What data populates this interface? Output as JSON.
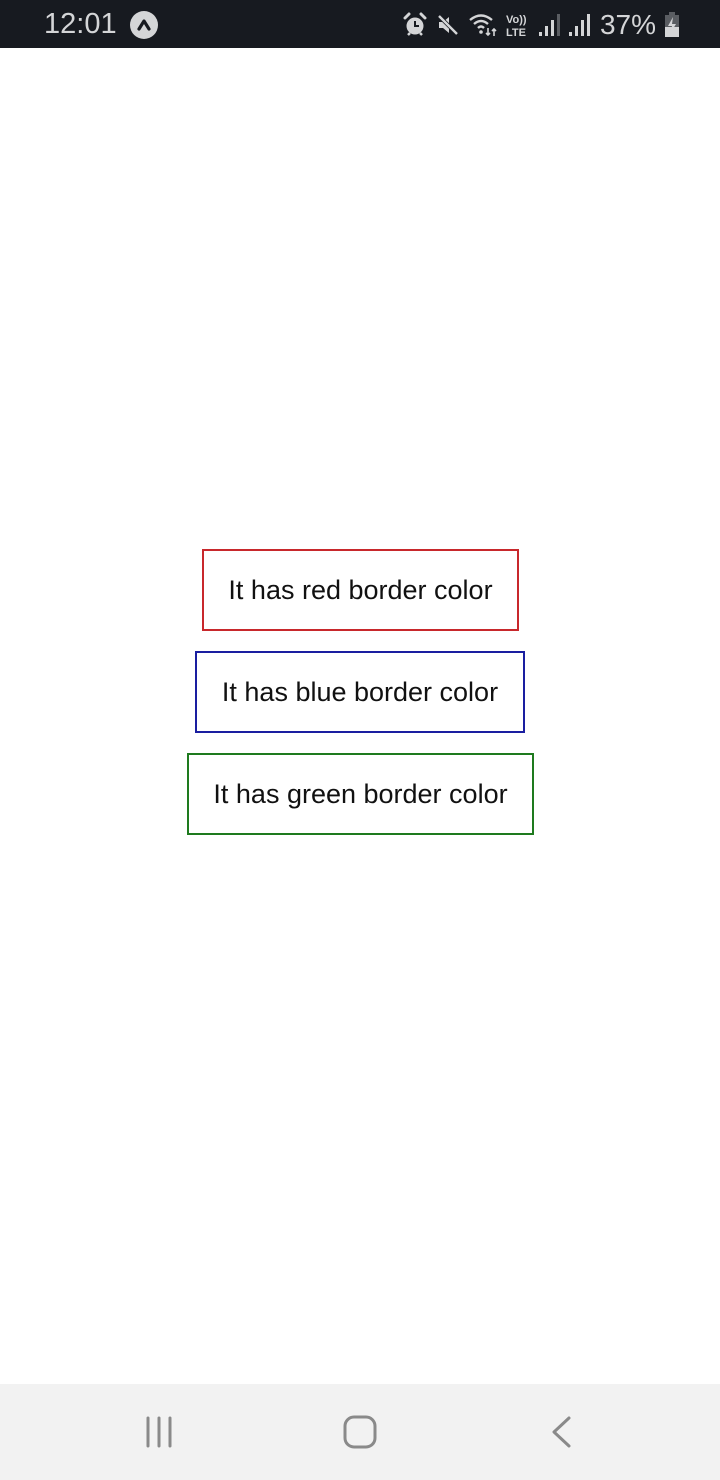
{
  "status_bar": {
    "time": "12:01",
    "battery_percent": "37%",
    "icons": [
      "app-notification-icon",
      "alarm-icon",
      "mute-icon",
      "wifi-icon",
      "volte-icon",
      "signal-icon",
      "signal-icon",
      "battery-charging-icon"
    ],
    "volte_top": "Vo))",
    "volte_bottom": "LTE"
  },
  "boxes": [
    {
      "label": "It has red border color",
      "border_color": "#c8282c"
    },
    {
      "label": "It has blue border color",
      "border_color": "#1a1ea0"
    },
    {
      "label": "It has green border color",
      "border_color": "#1e7a1e"
    }
  ],
  "nav_bar": {
    "buttons": [
      "recent-apps",
      "home",
      "back"
    ]
  }
}
